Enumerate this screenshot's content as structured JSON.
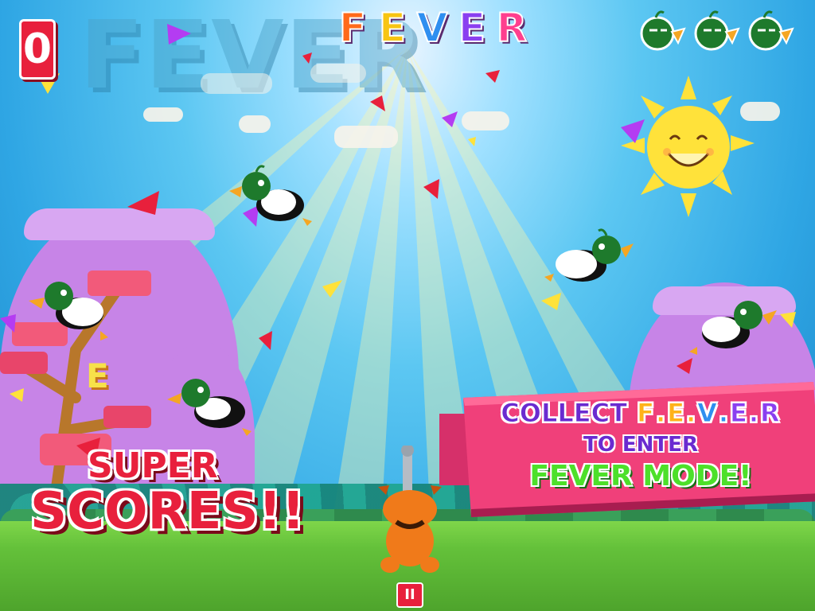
{
  "hud": {
    "score": "0",
    "fever_letters": [
      {
        "char": "F",
        "color": "#ff6a1a"
      },
      {
        "char": "E",
        "color": "#f7c512"
      },
      {
        "char": "V",
        "color": "#2f8ff0"
      },
      {
        "char": "E",
        "color": "#8a3ff0"
      },
      {
        "char": "R",
        "color": "#ff3f8e"
      }
    ],
    "lives_remaining": 3,
    "pause_label": "II"
  },
  "background_word": "FEVER",
  "floating_letter": "E",
  "promo": {
    "super": "SUPER",
    "scores": "SCORES!!",
    "collect_prefix": "COLLECT",
    "collect_letters": [
      {
        "char": "F",
        "color": "#ffb21a"
      },
      {
        "char": ".",
        "color": "#ffb21a"
      },
      {
        "char": "E",
        "color": "#ffb21a"
      },
      {
        "char": ".",
        "color": "#ffb21a"
      },
      {
        "char": "V",
        "color": "#2f8ff0"
      },
      {
        "char": ".",
        "color": "#2f8ff0"
      },
      {
        "char": "E",
        "color": "#8a3ff0"
      },
      {
        "char": ".",
        "color": "#8a3ff0"
      },
      {
        "char": "R",
        "color": "#8a3ff0"
      }
    ],
    "to_enter": "TO ENTER",
    "fever_mode": "FEVER MODE!"
  },
  "colors": {
    "accent_red": "#e8203c",
    "duck_green": "#1e7a2c",
    "banner_pink": "#f0407a",
    "mode_green": "#4de02a"
  },
  "icons": {
    "lives": "duck-head-icon",
    "pause": "pause-icon",
    "sun": "smiling-sun"
  }
}
